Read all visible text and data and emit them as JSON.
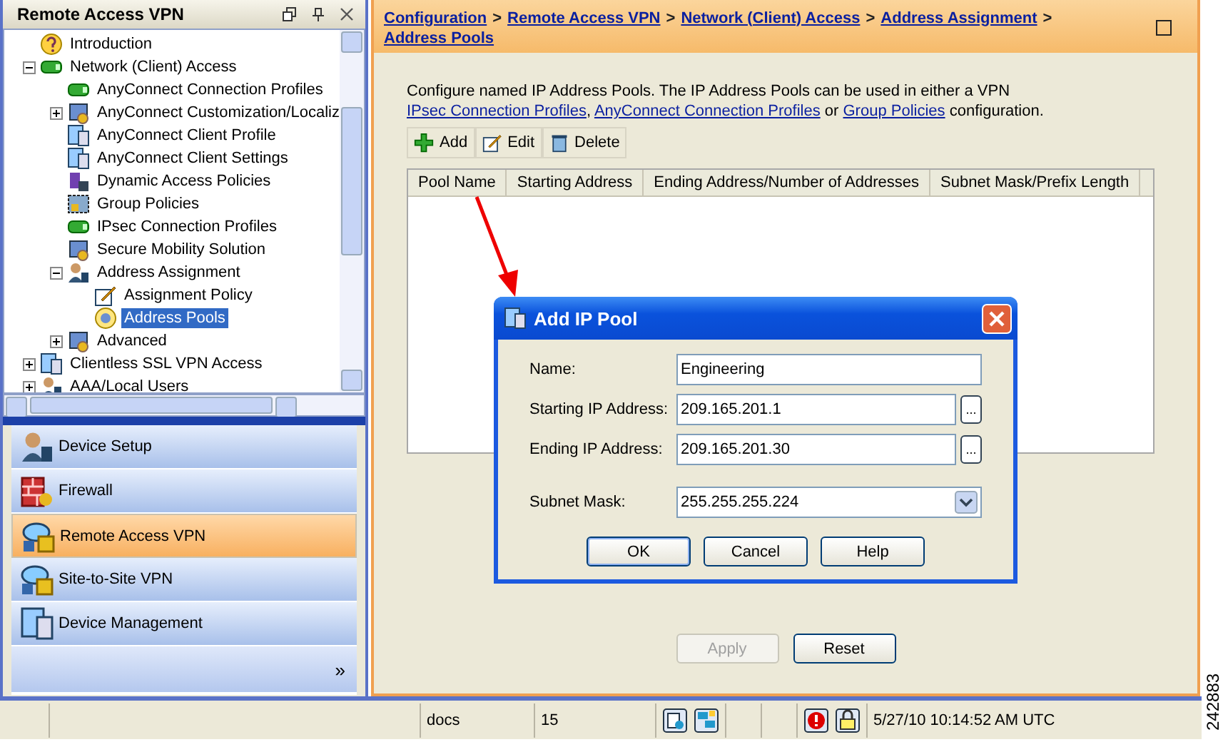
{
  "left_panel": {
    "title": "Remote Access VPN",
    "tree": [
      {
        "label": "Introduction",
        "kind": "help",
        "selected": false
      },
      {
        "label": "Network (Client) Access",
        "kind": "device",
        "expanded": true,
        "selected": false,
        "children": [
          {
            "label": "AnyConnect Connection Profiles",
            "kind": "device",
            "selected": false
          },
          {
            "label": "AnyConnect Customization/Localiz",
            "kind": "settings",
            "expanded": false,
            "selected": false
          },
          {
            "label": "AnyConnect Client Profile",
            "kind": "doc",
            "selected": false
          },
          {
            "label": "AnyConnect Client Settings",
            "kind": "doc",
            "selected": false
          },
          {
            "label": "Dynamic Access Policies",
            "kind": "policy",
            "selected": false
          },
          {
            "label": "Group Policies",
            "kind": "group",
            "selected": false
          },
          {
            "label": "IPsec Connection Profiles",
            "kind": "device",
            "selected": false
          },
          {
            "label": "Secure Mobility Solution",
            "kind": "settings",
            "selected": false
          },
          {
            "label": "Address Assignment",
            "kind": "person",
            "expanded": true,
            "selected": false,
            "children": [
              {
                "label": "Assignment Policy",
                "kind": "edit",
                "selected": false
              },
              {
                "label": "Address Pools",
                "kind": "ip",
                "selected": true
              }
            ]
          },
          {
            "label": "Advanced",
            "kind": "settings",
            "expanded": false,
            "selected": false
          }
        ]
      },
      {
        "label": "Clientless SSL VPN Access",
        "kind": "doc",
        "expanded": false,
        "selected": false
      },
      {
        "label": "AAA/Local Users",
        "kind": "person",
        "expanded": false,
        "selected": false
      }
    ],
    "nav": [
      {
        "label": "Device Setup",
        "kind": "person",
        "selected": false
      },
      {
        "label": "Firewall",
        "kind": "firewall",
        "selected": false
      },
      {
        "label": "Remote Access VPN",
        "kind": "vpn",
        "selected": true
      },
      {
        "label": "Site-to-Site VPN",
        "kind": "vpn",
        "selected": false
      },
      {
        "label": "Device Management",
        "kind": "doc",
        "selected": false
      }
    ],
    "more": "»"
  },
  "main": {
    "breadcrumb": [
      "Configuration",
      "Remote Access VPN",
      "Network (Client) Access",
      "Address Assignment",
      "Address Pools"
    ],
    "separator": ">",
    "description": [
      {
        "text": "Configure named IP Address Pools. The IP Address Pools can be used in either a VPN ",
        "link": false
      },
      {
        "text": "IPsec Connection Profiles",
        "link": true
      },
      {
        "text": ", ",
        "link": false
      },
      {
        "text": "AnyConnect Connection Profiles",
        "link": true
      },
      {
        "text": " or ",
        "link": false
      },
      {
        "text": "Group Policies",
        "link": true
      },
      {
        "text": " configuration.",
        "link": false
      }
    ],
    "toolbar": [
      {
        "label": "Add",
        "kind": "add"
      },
      {
        "label": "Edit",
        "kind": "edit"
      },
      {
        "label": "Delete",
        "kind": "delete"
      }
    ],
    "table": {
      "columns": [
        "Pool Name",
        "Starting Address",
        "Ending Address/Number of Addresses",
        "Subnet Mask/Prefix Length"
      ]
    },
    "buttons": [
      {
        "label": "Apply",
        "disabled": true
      },
      {
        "label": "Reset",
        "disabled": false
      }
    ]
  },
  "dialog": {
    "title": "Add IP Pool",
    "fields": [
      {
        "kind": "text",
        "label": "Name:",
        "value": "Engineering"
      },
      {
        "kind": "browse",
        "label": "Starting IP Address:",
        "value": "209.165.201.1",
        "button": "..."
      },
      {
        "kind": "browse",
        "label": "Ending IP Address:",
        "value": "209.165.201.30",
        "button": "..."
      },
      {
        "kind": "select",
        "label": "Subnet Mask:",
        "value": "255.255.255.224"
      }
    ],
    "buttons": [
      {
        "label": "OK",
        "default": true
      },
      {
        "label": "Cancel",
        "default": false
      },
      {
        "label": "Help",
        "default": false
      }
    ]
  },
  "status_bar": {
    "user": "docs",
    "privilege": "15",
    "time": "5/27/10 10:14:52 AM UTC"
  },
  "figure_number": "242883"
}
